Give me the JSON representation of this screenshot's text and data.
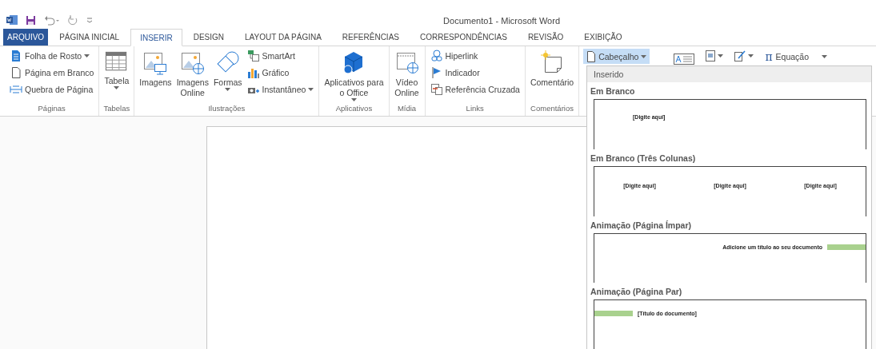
{
  "window": {
    "title": "Documento1 - Microsoft Word"
  },
  "tabs": [
    {
      "label": "ARQUIVO",
      "kind": "file",
      "selected": false
    },
    {
      "label": "PÁGINA INICIAL",
      "kind": "tab",
      "selected": false
    },
    {
      "label": "INSERIR",
      "kind": "tab",
      "selected": true
    },
    {
      "label": "DESIGN",
      "kind": "tab",
      "selected": false
    },
    {
      "label": "LAYOUT DA PÁGINA",
      "kind": "tab",
      "selected": false
    },
    {
      "label": "REFERÊNCIAS",
      "kind": "tab",
      "selected": false
    },
    {
      "label": "CORRESPONDÊNCIAS",
      "kind": "tab",
      "selected": false
    },
    {
      "label": "REVISÃO",
      "kind": "tab",
      "selected": false
    },
    {
      "label": "EXIBIÇÃO",
      "kind": "tab",
      "selected": false
    }
  ],
  "ribbon": {
    "groups": [
      {
        "label": "Páginas",
        "items": [
          {
            "label": "Folha de Rosto",
            "kind": "small",
            "dropdown": true
          },
          {
            "label": "Página em Branco",
            "kind": "small",
            "dropdown": false
          },
          {
            "label": "Quebra de Página",
            "kind": "small",
            "dropdown": false
          }
        ]
      },
      {
        "label": "Tabelas",
        "items": [
          {
            "label": "Tabela",
            "kind": "large",
            "dropdown": true
          }
        ]
      },
      {
        "label": "Ilustrações",
        "items": [
          {
            "label": "Imagens",
            "kind": "large",
            "dropdown": false
          },
          {
            "label": "Imagens\nOnline",
            "kind": "large",
            "dropdown": false
          },
          {
            "label": "Formas",
            "kind": "large",
            "dropdown": true
          },
          {
            "label": "SmartArt",
            "kind": "small",
            "dropdown": false
          },
          {
            "label": "Gráfico",
            "kind": "small",
            "dropdown": false
          },
          {
            "label": "Instantâneo",
            "kind": "small",
            "dropdown": true
          }
        ]
      },
      {
        "label": "Aplicativos",
        "items": [
          {
            "label": "Aplicativos para\no Office",
            "kind": "large",
            "dropdown": true
          }
        ]
      },
      {
        "label": "Mídia",
        "items": [
          {
            "label": "Vídeo\nOnline",
            "kind": "large",
            "dropdown": false
          }
        ]
      },
      {
        "label": "Links",
        "items": [
          {
            "label": "Hiperlink",
            "kind": "small",
            "dropdown": false
          },
          {
            "label": "Indicador",
            "kind": "small",
            "dropdown": false
          },
          {
            "label": "Referência Cruzada",
            "kind": "small",
            "dropdown": false
          }
        ]
      },
      {
        "label": "Comentários",
        "items": [
          {
            "label": "Comentário",
            "kind": "large",
            "dropdown": false
          }
        ]
      }
    ],
    "header_button": {
      "label": "Cabeçalho",
      "selected": true
    },
    "equation_button": {
      "icon": "π",
      "label": "Equação"
    }
  },
  "gallery": {
    "header": "Inserido",
    "items": [
      {
        "title": "Em Branco",
        "kind": "blank",
        "texts": [
          "[Digite aqui]"
        ]
      },
      {
        "title": "Em Branco (Três Colunas)",
        "kind": "three_columns",
        "texts": [
          "[Digite aqui]",
          "[Digite aqui]",
          "[Digite aqui]"
        ]
      },
      {
        "title": "Animação (Página Ímpar)",
        "kind": "bar_right",
        "texts": [
          "Adicione um título ao seu documento"
        ]
      },
      {
        "title": "Animação (Página Par)",
        "kind": "bar_left",
        "texts": [
          "[Título do documento]"
        ]
      }
    ]
  }
}
